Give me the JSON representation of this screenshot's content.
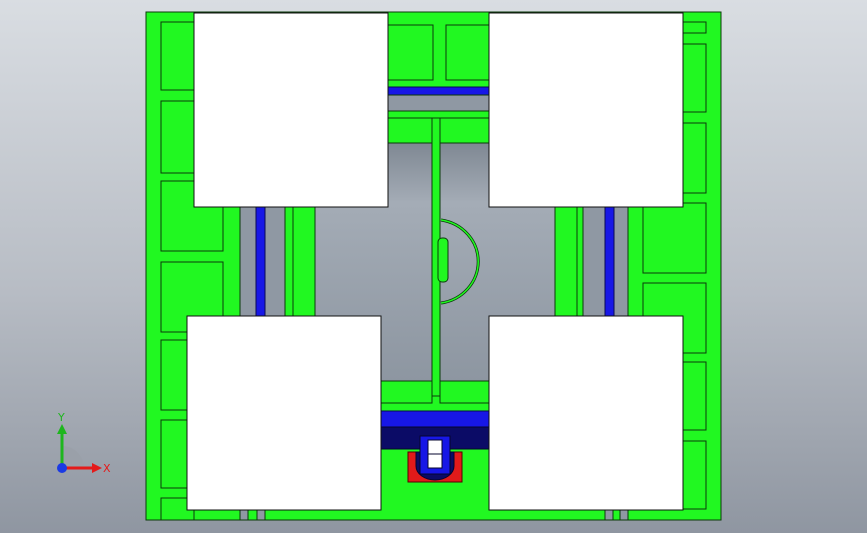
{
  "viewport": {
    "background_top": "#d9dde2",
    "background_bottom": "#8f96a1"
  },
  "colors": {
    "body_green": "#21f821",
    "outline": "#0a3a0a",
    "slot_blue": "#1717e6",
    "dark_navy": "#0b0b66",
    "motor_red": "#e11a1a",
    "cavity_gray": "#9aa3ad",
    "pad_white": "#ffffff",
    "axis_x": "#e41a1a",
    "axis_y": "#1eb61e",
    "axis_z": "#1a3ae4"
  },
  "triad": {
    "x_label": "X",
    "y_label": "Y"
  }
}
